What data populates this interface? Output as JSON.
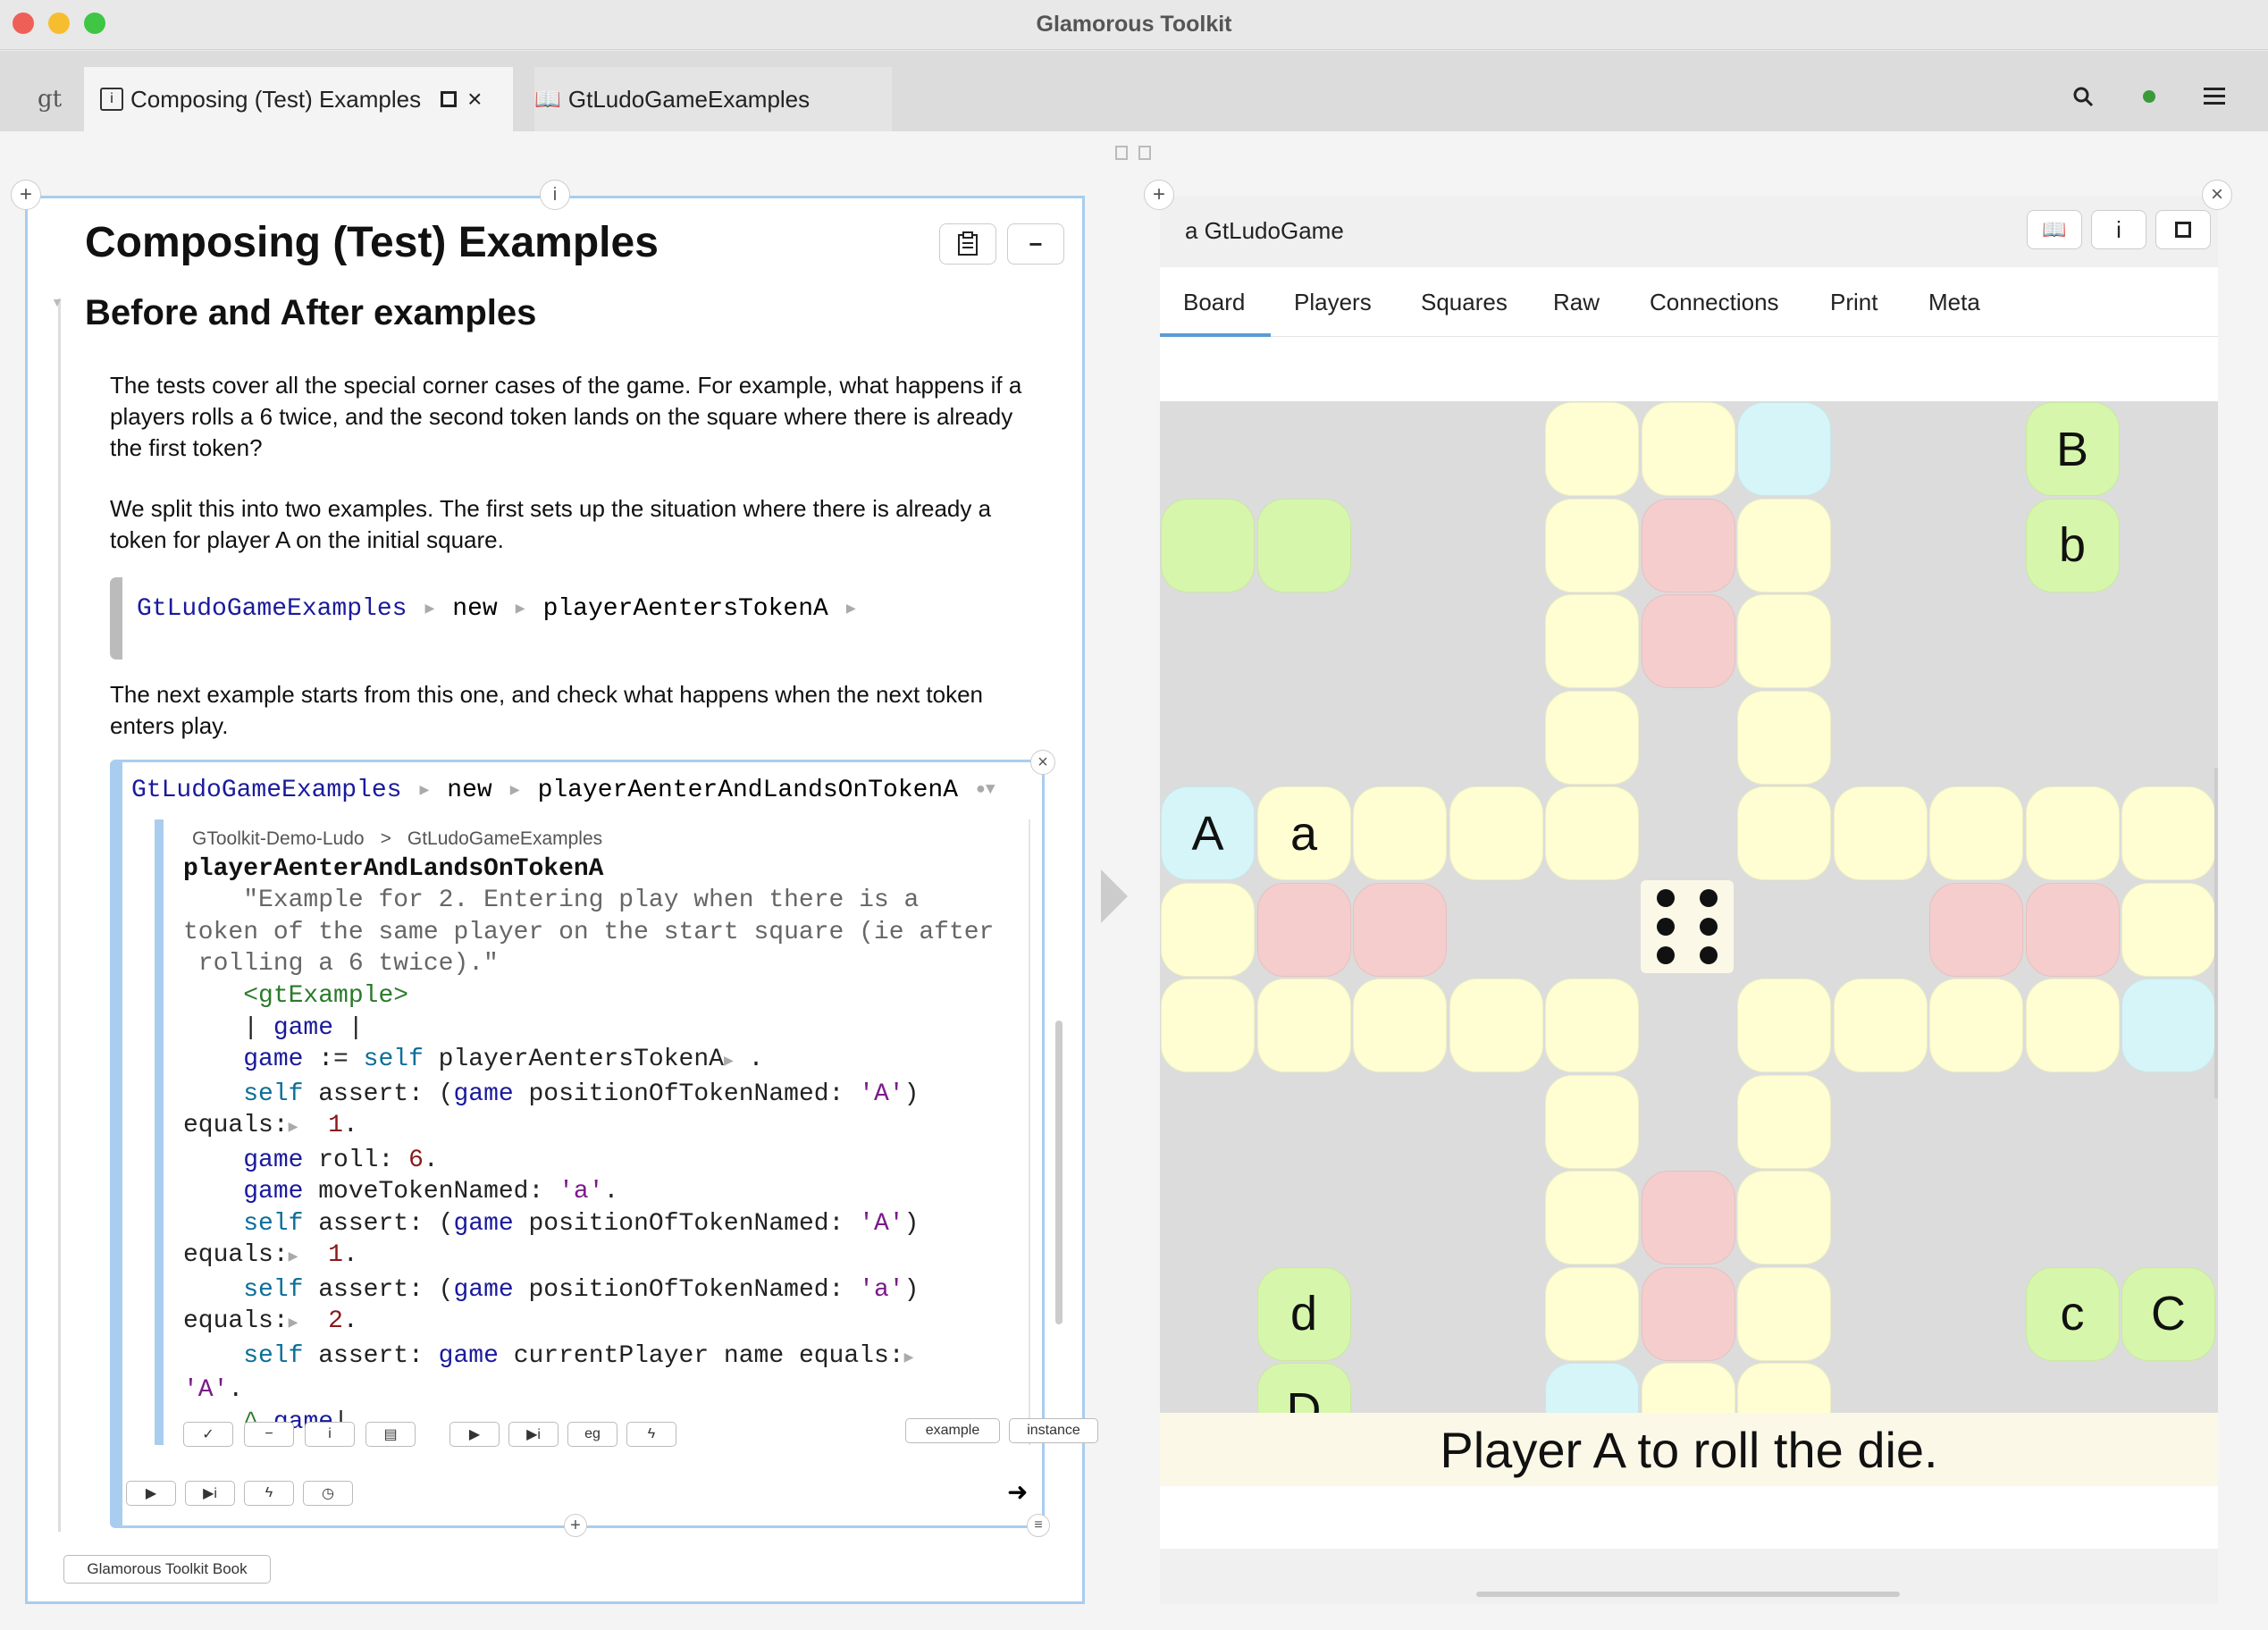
{
  "window": {
    "title": "Glamorous Toolkit"
  },
  "tabs": {
    "gt_label": "gt",
    "tab1_label": "Composing (Test) Examples",
    "tab2_label": "GtLudoGameExamples"
  },
  "left": {
    "title": "Composing (Test) Examples",
    "heading": "Before and After examples",
    "para1": [
      "The tests cover all the special corner cases of the game. For example, what happens if a",
      "players rolls a 6 twice, and the second token lands on the square where there is already",
      "the first token?"
    ],
    "para2": [
      "We split this into two examples. The first sets up the situation where there is already a",
      "token for player A on the initial square."
    ],
    "snippet1": {
      "cls": "GtLudoGameExamples",
      "msg1": "new",
      "msg2": "playerAentersTokenA"
    },
    "para3": [
      "The next example starts from this one, and check what happens when the next token",
      "enters play."
    ],
    "snippet2": {
      "cls": "GtLudoGameExamples",
      "msg1": "new",
      "msg2": "playerAenterAndLandsOnTokenA"
    },
    "breadcrumb": {
      "package": "GToolkit-Demo-Ludo",
      "sep": ">",
      "cls": "GtLudoGameExamples"
    },
    "method_name": "playerAenterAndLandsOnTokenA",
    "comment": [
      "\"Example for 2. Entering play when there is a",
      "token of the same player on the start square (ie after",
      " rolling a 6 twice).\""
    ],
    "pragma": "<gtExample>",
    "toolbar_tags": [
      "example",
      "instance"
    ],
    "book_button": "Glamorous Toolkit Book"
  },
  "right": {
    "title": "a GtLudoGame",
    "views": [
      "Board",
      "Players",
      "Squares",
      "Raw",
      "Connections",
      "Print",
      "Meta"
    ],
    "active_view": "Board",
    "status": "Player A to roll the die.",
    "die_value": 6,
    "labels": {
      "A": "A",
      "a": "a",
      "B": "B",
      "b": "b",
      "C": "C",
      "c": "c",
      "D": "D",
      "d": "d"
    }
  },
  "colors": {
    "yellow": "#fefed2",
    "red": "#f5cdcd",
    "blue": "#d5f5f8",
    "green": "#d6f7ab",
    "board_bg": "#dcdcdc"
  }
}
